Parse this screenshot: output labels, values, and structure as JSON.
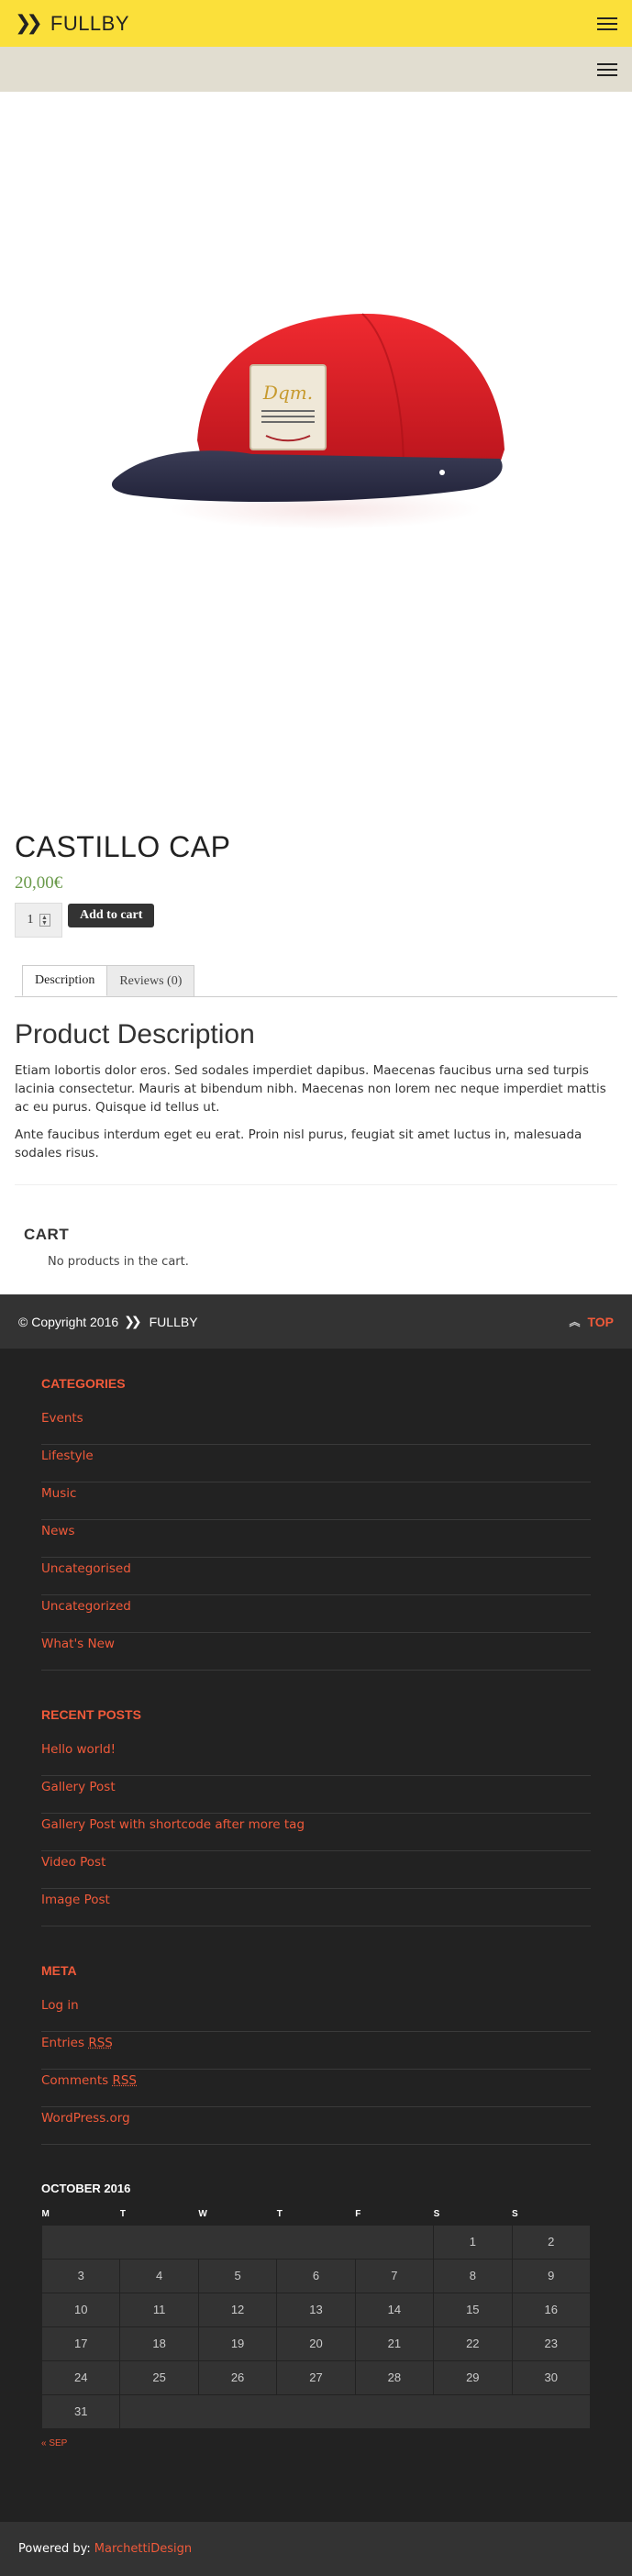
{
  "header": {
    "brand": "FULLBY",
    "chevrons": "❯❯"
  },
  "product": {
    "title": "CASTILLO CAP",
    "price": "20,00€",
    "quantity": "1",
    "add_to_cart": "Add to cart",
    "image_label": "Dqm."
  },
  "tabs": [
    {
      "label": "Description"
    },
    {
      "label": "Reviews (0)"
    }
  ],
  "description": {
    "heading": "Product Description",
    "paragraphs": [
      "Etiam lobortis dolor eros. Sed sodales imperdiet dapibus. Maecenas faucibus urna sed turpis lacinia consectetur. Mauris at bibendum nibh. Maecenas non lorem nec neque imperdiet mattis ac eu purus. Quisque id tellus ut.",
      "Ante faucibus interdum eget eu erat. Proin nisl purus, feugiat sit amet luctus in, malesuada sodales risus."
    ]
  },
  "cart": {
    "heading": "CART",
    "empty_text": "No products in the cart."
  },
  "copyright": {
    "text": "© Copyright 2016",
    "brand": "FULLBY",
    "top_label": "TOP"
  },
  "categories": {
    "heading": "CATEGORIES",
    "items": [
      "Events",
      "Lifestyle",
      "Music",
      "News",
      "Uncategorised",
      "Uncategorized",
      "What's New"
    ]
  },
  "recent_posts": {
    "heading": "RECENT POSTS",
    "items": [
      "Hello world!",
      "Gallery Post",
      "Gallery Post with shortcode after more tag",
      "Video Post",
      "Image Post"
    ]
  },
  "meta": {
    "heading": "META",
    "items": [
      "Log in",
      "Entries",
      "Comments",
      "WordPress.org"
    ],
    "rss": "RSS"
  },
  "calendar": {
    "heading": "OCTOBER 2016",
    "days": [
      "M",
      "T",
      "W",
      "T",
      "F",
      "S",
      "S"
    ],
    "weeks": [
      [
        "",
        "",
        "",
        "",
        "",
        "1",
        "2"
      ],
      [
        "3",
        "4",
        "5",
        "6",
        "7",
        "8",
        "9"
      ],
      [
        "10",
        "11",
        "12",
        "13",
        "14",
        "15",
        "16"
      ],
      [
        "17",
        "18",
        "19",
        "20",
        "21",
        "22",
        "23"
      ],
      [
        "24",
        "25",
        "26",
        "27",
        "28",
        "29",
        "30"
      ],
      [
        "31",
        "",
        "",
        "",
        "",
        "",
        ""
      ]
    ],
    "prev": "« SEP"
  },
  "powered": {
    "label": "Powered by:",
    "link": "MarchettiDesign"
  },
  "colors": {
    "header_yellow": "#fbe03a",
    "subbar": "#e1ddd0",
    "accent": "#f05a3a",
    "price_green": "#6a9a4a",
    "footer_dark": "#222222",
    "bar_dark": "#333333",
    "cap_red": "#e0222a",
    "cap_navy": "#2d2f45"
  }
}
